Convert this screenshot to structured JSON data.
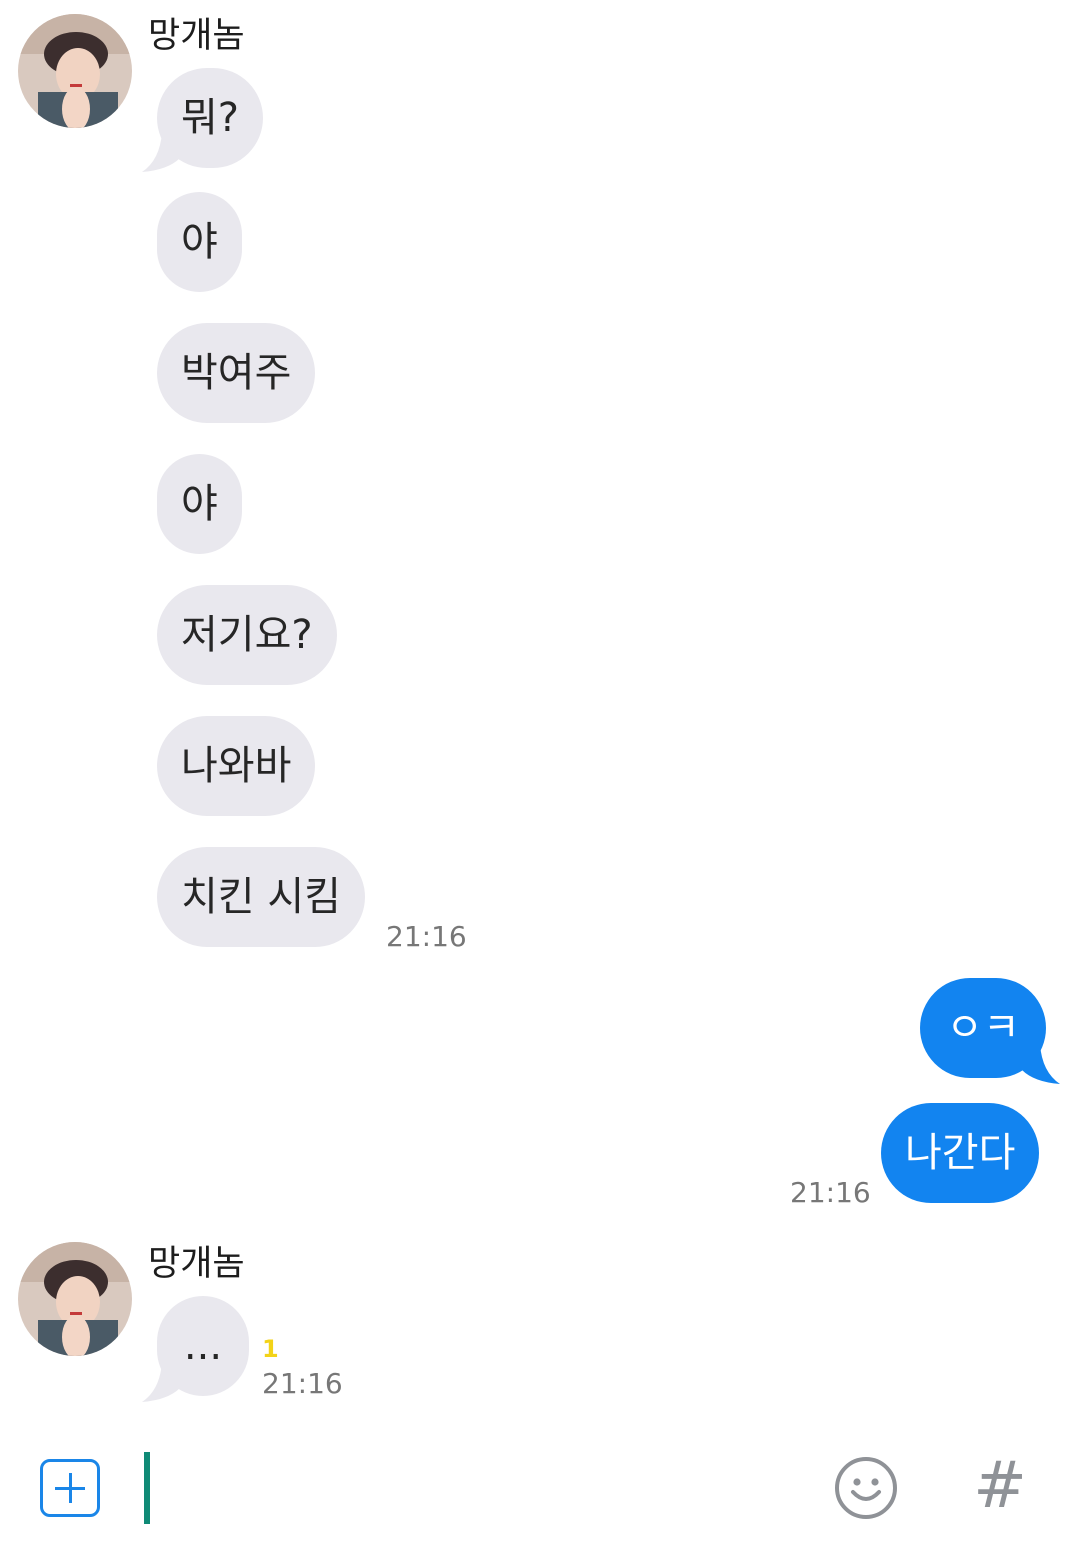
{
  "groups": [
    {
      "sender": "망개놈",
      "messages": [
        "뭐?",
        "야",
        "박여주",
        "야",
        "저기요?",
        "나와바",
        "치킨 시킴"
      ],
      "time": "21:16"
    },
    {
      "sender": "me",
      "messages": [
        "ㅇㅋ",
        "나간다"
      ],
      "time": "21:16"
    },
    {
      "sender": "망개놈",
      "messages": [
        "..."
      ],
      "unread_count": "1",
      "time": "21:16"
    }
  ],
  "compose": {
    "placeholder": "",
    "value": ""
  },
  "icons": {
    "attach": "plus-square-icon",
    "emoji": "smiley-icon",
    "hashtag": "hash-icon"
  },
  "colors": {
    "incoming_bubble": "#e9e8ee",
    "outgoing_bubble": "#1284f0",
    "cursor": "#0f8a76",
    "unread": "#f3d318",
    "accent": "#1a86e8"
  }
}
